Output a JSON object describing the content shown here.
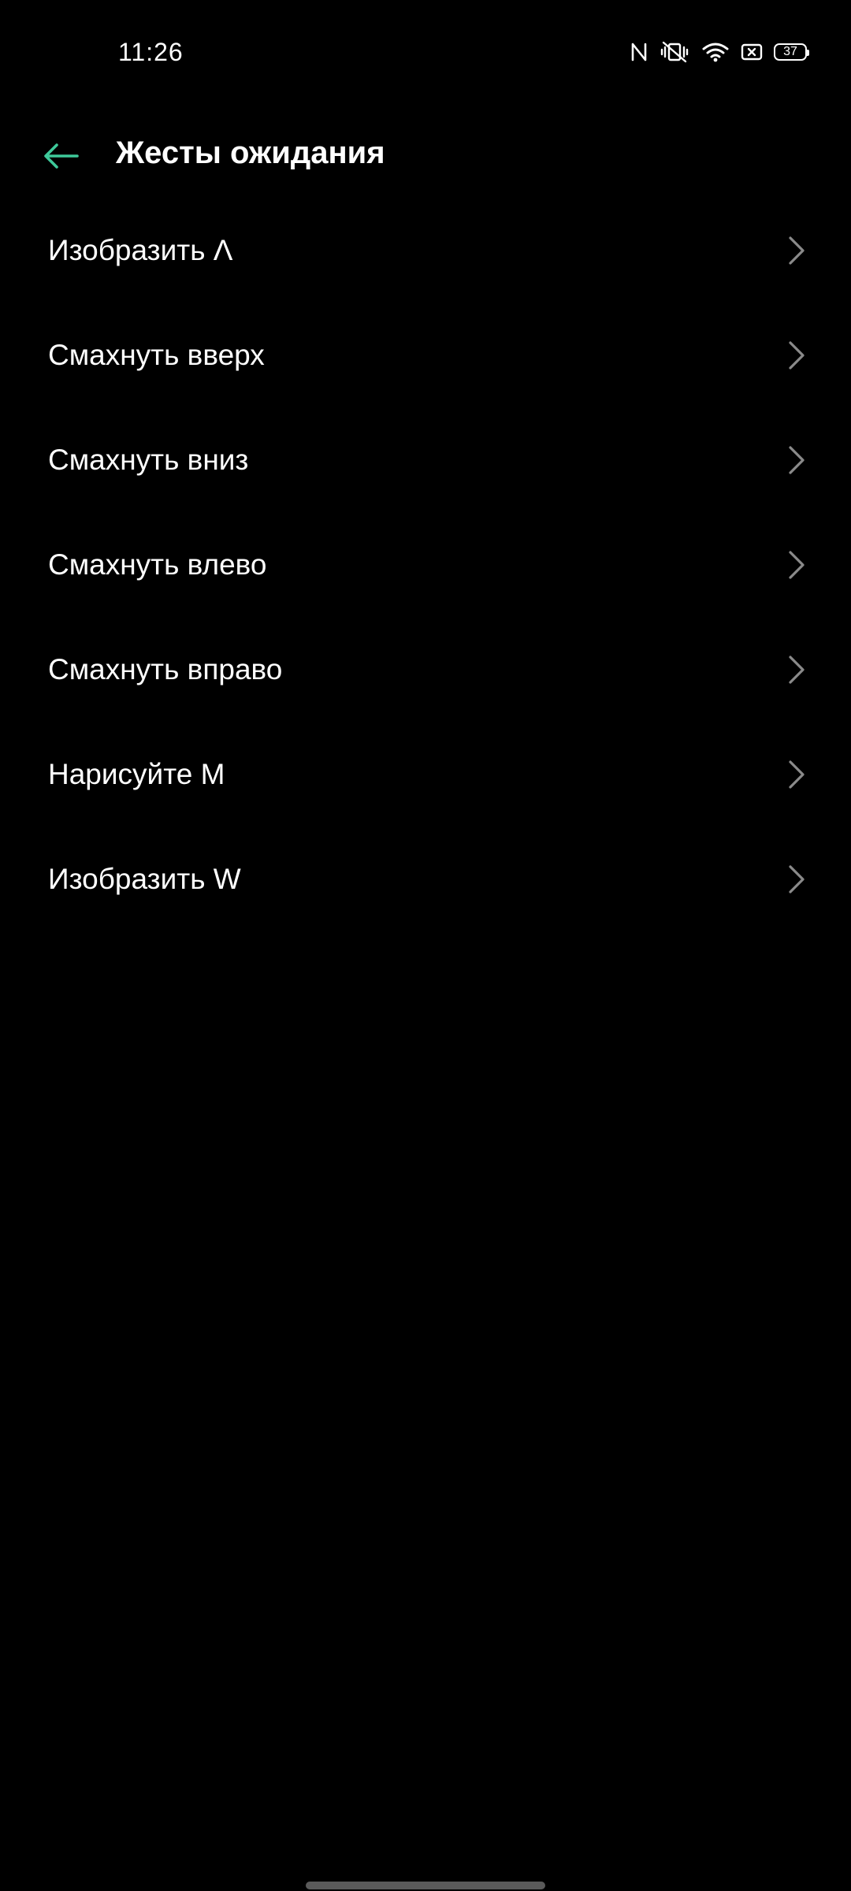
{
  "status_bar": {
    "time": "11:26",
    "icons": [
      "nfc-icon",
      "vibrate-off-icon",
      "wifi-icon",
      "sim-icon",
      "battery-icon"
    ],
    "battery_level": "37"
  },
  "header": {
    "back_icon": "arrow-left-icon",
    "title": "Жесты ожидания"
  },
  "gestures": [
    {
      "label": "Изобразить Λ"
    },
    {
      "label": "Смахнуть вверх"
    },
    {
      "label": "Смахнуть вниз"
    },
    {
      "label": "Смахнуть влево"
    },
    {
      "label": "Смахнуть вправо"
    },
    {
      "label": "Нарисуйте M"
    },
    {
      "label": "Изобразить W"
    }
  ],
  "colors": {
    "background": "#000000",
    "accent": "#3ec99a",
    "text": "#ffffff",
    "chevron": "#8a8a8a"
  }
}
